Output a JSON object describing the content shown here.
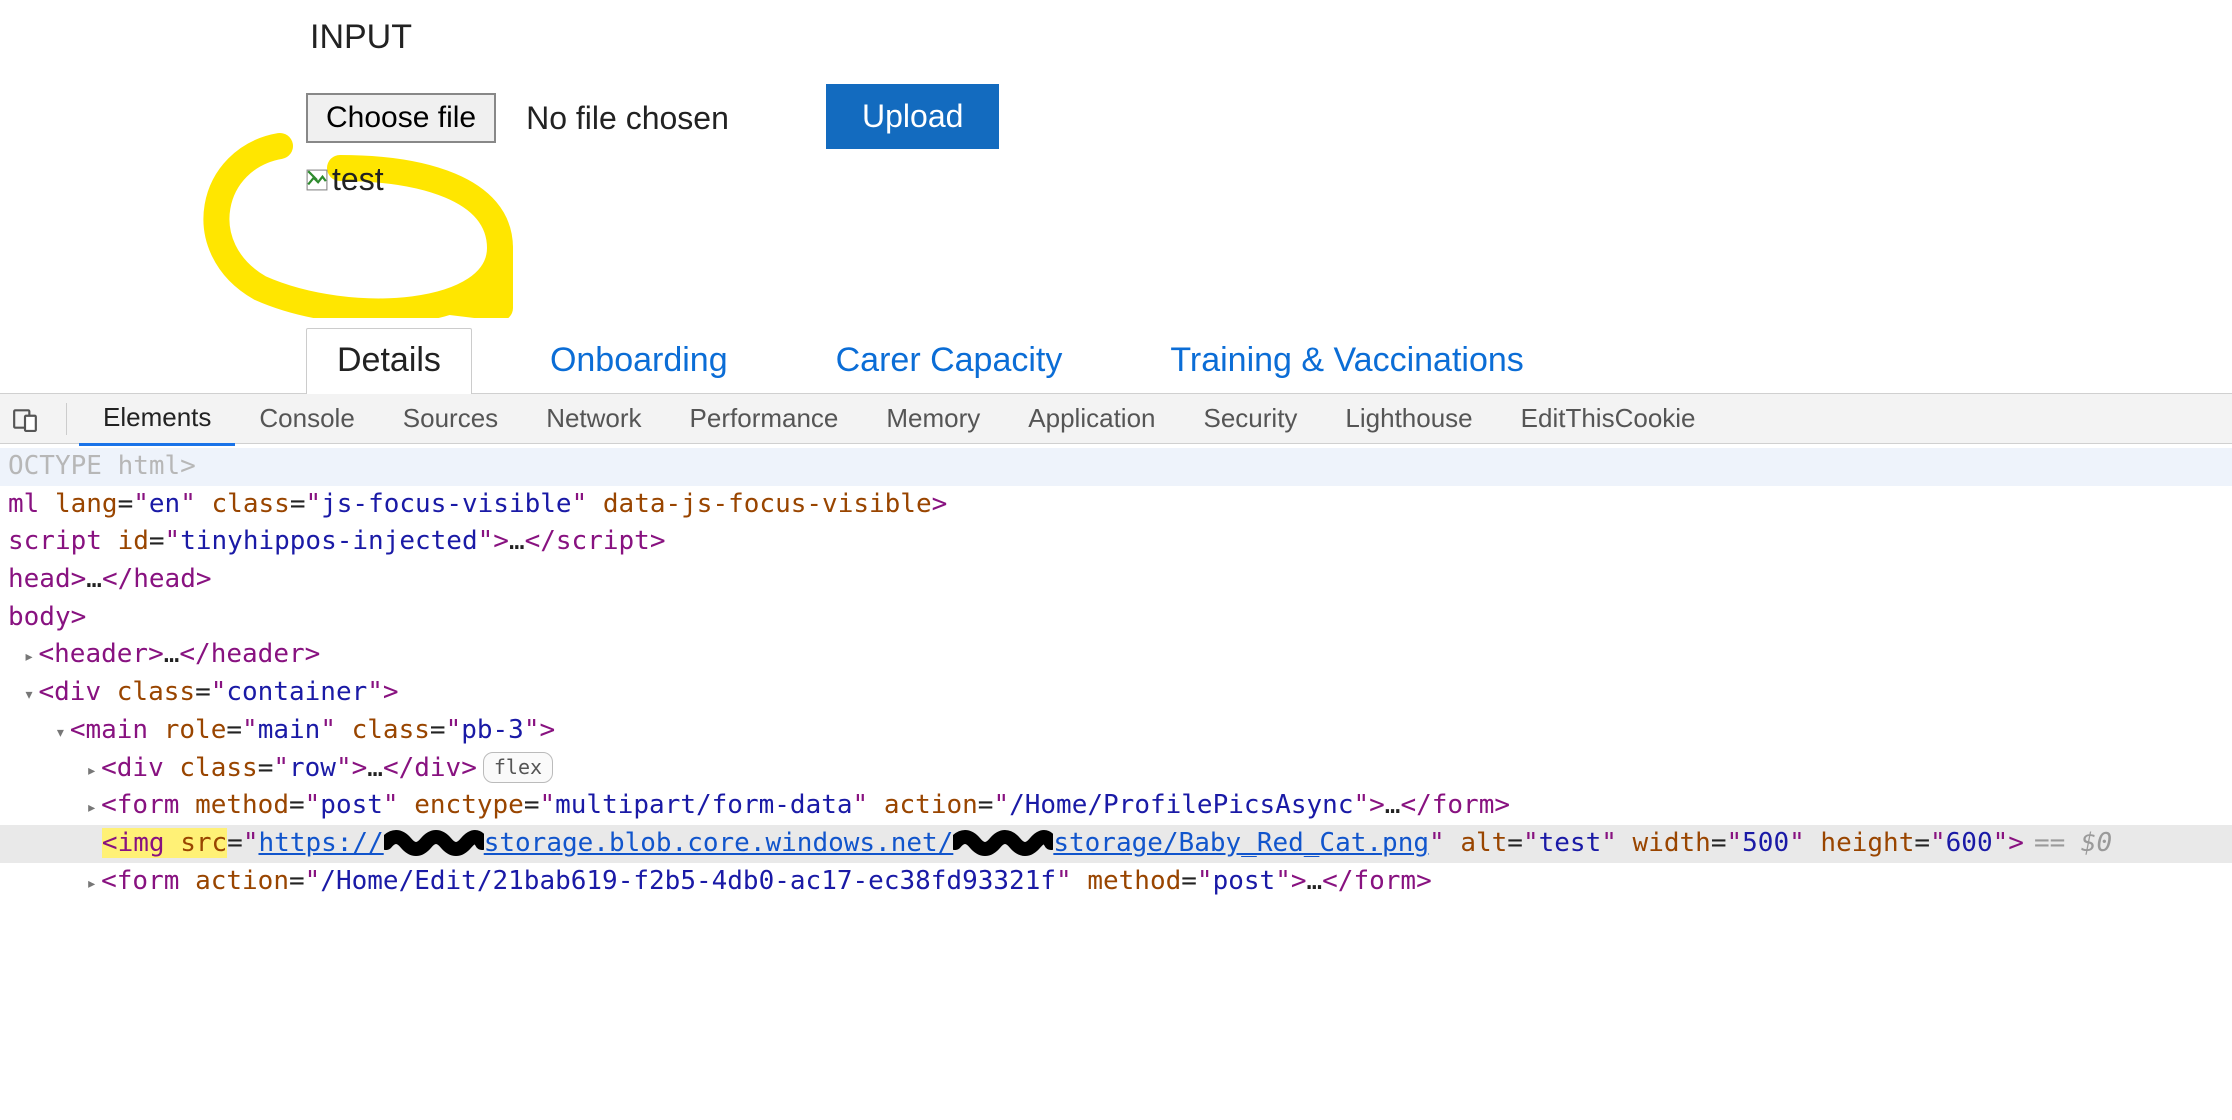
{
  "form": {
    "label": "INPUT",
    "choose_label": "Choose file",
    "file_status": "No file chosen",
    "upload_label": "Upload",
    "broken_alt": "test"
  },
  "tabs": [
    {
      "label": "Details",
      "active": true
    },
    {
      "label": "Onboarding",
      "active": false
    },
    {
      "label": "Carer Capacity",
      "active": false
    },
    {
      "label": "Training & Vaccinations",
      "active": false
    }
  ],
  "devtools": {
    "tabs": [
      "Elements",
      "Console",
      "Sources",
      "Network",
      "Performance",
      "Memory",
      "Application",
      "Security",
      "Lighthouse",
      "EditThisCookie"
    ],
    "active_tab": "Elements",
    "dom": {
      "doctype": "OCTYPE html>",
      "html_open": {
        "tag": "ml",
        "attrs": [
          [
            "lang",
            "en"
          ],
          [
            "class",
            "js-focus-visible"
          ]
        ],
        "flag_attr": "data-js-focus-visible"
      },
      "script_line": {
        "tag": "script",
        "attrs": [
          [
            "id",
            "tinyhippos-injected"
          ]
        ]
      },
      "head_tag": "head",
      "body_tag": "body",
      "header_tag": "header",
      "container_div": {
        "tag": "div",
        "attrs": [
          [
            "class",
            "container"
          ]
        ]
      },
      "main_line": {
        "tag": "main",
        "attrs": [
          [
            "role",
            "main"
          ],
          [
            "class",
            "pb-3"
          ]
        ]
      },
      "row_div": {
        "tag": "div",
        "attrs": [
          [
            "class",
            "row"
          ]
        ],
        "badge": "flex"
      },
      "form1": {
        "tag": "form",
        "attrs": [
          [
            "method",
            "post"
          ],
          [
            "enctype",
            "multipart/form-data"
          ],
          [
            "action",
            "/Home/ProfilePicsAsync"
          ]
        ]
      },
      "img_line": {
        "tag": "img",
        "src_prefix": "https://",
        "src_mid1": "storage.blob.core.windows.net/",
        "src_mid2": "storage/Baby_Red_Cat.png",
        "alt": "test",
        "width": "500",
        "height": "600",
        "selected_hint": "== $0"
      },
      "form2": {
        "tag": "form",
        "attrs": [
          [
            "action",
            "/Home/Edit/21bab619-f2b5-4db0-ac17-ec38fd93321f"
          ],
          [
            "method",
            "post"
          ]
        ]
      }
    }
  }
}
